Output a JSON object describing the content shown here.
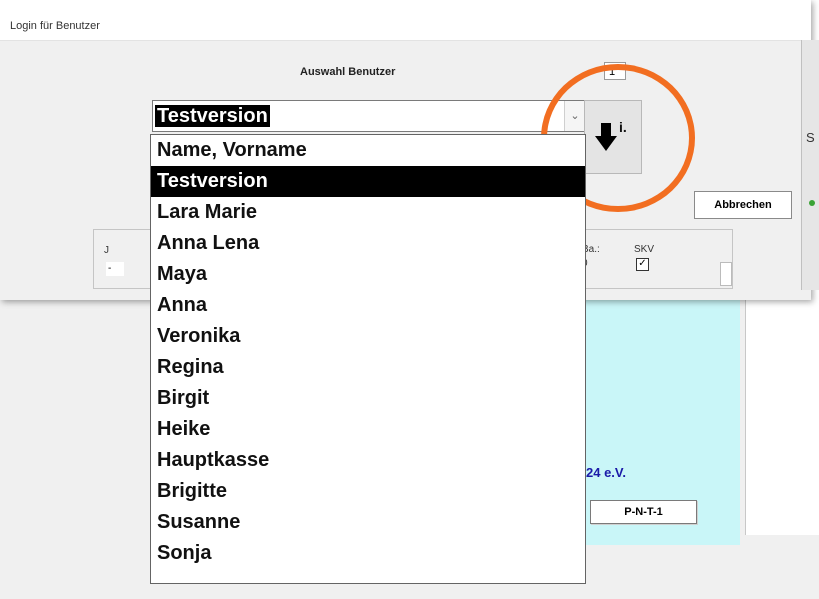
{
  "dialog": {
    "title": "Login für Benutzer",
    "select_label": "Auswahl Benutzer",
    "small_field_value": "1",
    "combo_value": "Testversion",
    "combo_arrow": "⌄",
    "down_button_text": "i.",
    "cancel_label": "Abbrechen",
    "right_edge_letter": "S"
  },
  "user_list": [
    "Name, Vorname",
    "Testversion",
    "Lara Marie",
    "Anna Lena",
    "Maya",
    "Anna",
    "Veronika",
    "Regina",
    "Birgit",
    "Heike",
    "Hauptkasse",
    "Brigitte",
    "Susanne",
    "Sonja"
  ],
  "selected_index": 1,
  "groupbox": {
    "left_label": "J",
    "left_value": "-",
    "label_1": "Ba.:",
    "label_2": "SKV",
    "value_1": "0",
    "check_mark": "✓"
  },
  "background": {
    "org_text": "24 e.V.",
    "code_text": "P-N-T-1"
  },
  "colors": {
    "highlight_ring": "#f26e21",
    "selection": "#000000",
    "cyan_panel": "#c9f6f8",
    "org_text": "#1a1aa8"
  },
  "icons": {
    "down_button": "arrow-down-icon"
  }
}
